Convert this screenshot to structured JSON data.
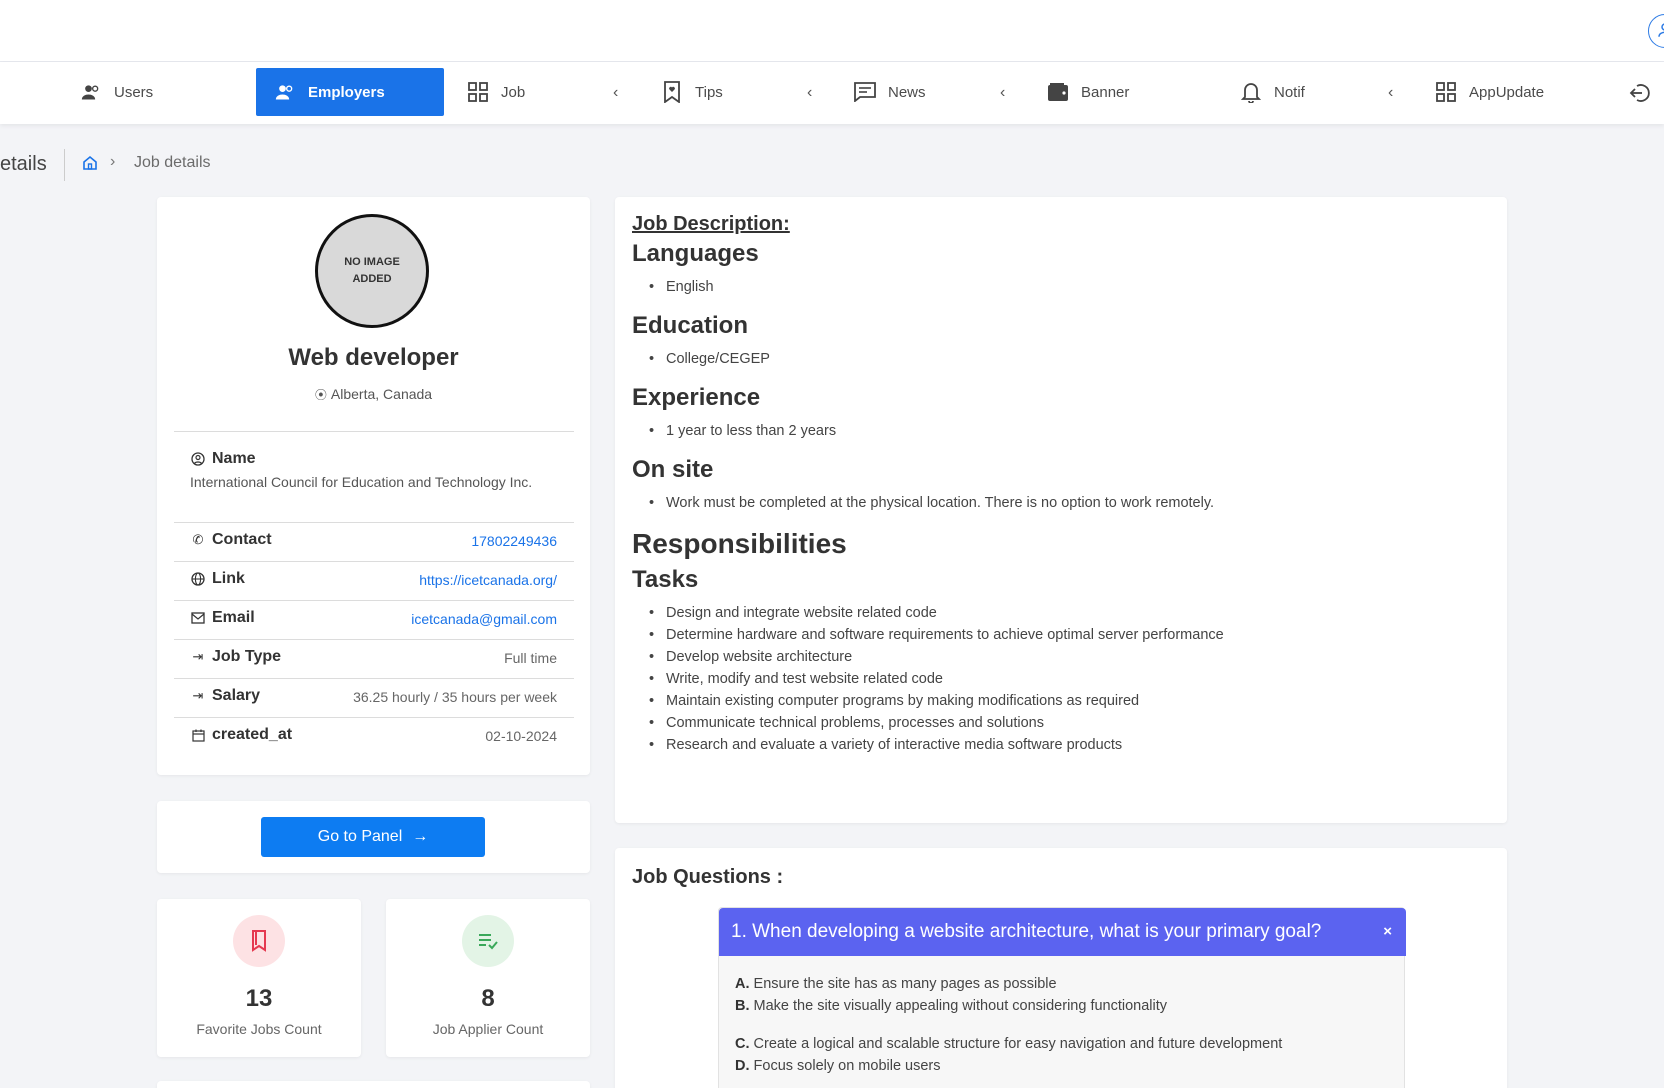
{
  "nav": {
    "items": [
      {
        "label": "Users",
        "icon": "users-icon"
      },
      {
        "label": "Employers",
        "icon": "users-icon"
      },
      {
        "label": "Job",
        "icon": "grid-icon"
      },
      {
        "label": "Tips",
        "icon": "bookmark-heart-icon"
      },
      {
        "label": "News",
        "icon": "message-icon"
      },
      {
        "label": "Banner",
        "icon": "wallet-icon"
      },
      {
        "label": "Notif",
        "icon": "bell-icon"
      },
      {
        "label": "AppUpdate",
        "icon": "grid-icon"
      }
    ],
    "active": "Employers",
    "accent": "#1a73e8"
  },
  "breadcrumb": {
    "title": "etails",
    "current": "Job details"
  },
  "profile": {
    "no_image_text": "NO IMAGE ADDED",
    "job_title": "Web developer",
    "location": "Alberta, Canada",
    "rows": {
      "name_label": "Name",
      "name_value": "International Council for Education and Technology Inc.",
      "contact_label": "Contact",
      "contact_value": "17802249436",
      "link_label": "Link",
      "link_value": "https://icetcanada.org/",
      "email_label": "Email",
      "email_value": "icetcanada@gmail.com",
      "jobtype_label": "Job Type",
      "jobtype_value": "Full time",
      "salary_label": "Salary",
      "salary_value": "36.25 hourly / 35 hours per week",
      "created_label": "created_at",
      "created_value": "02-10-2024"
    }
  },
  "panel_button": "Go to Panel",
  "stats": {
    "favorite_count": "13",
    "favorite_label": "Favorite Jobs Count",
    "applier_count": "8",
    "applier_label": "Job Applier Count"
  },
  "description": {
    "heading": "Job Description:",
    "languages_title": "Languages",
    "languages": [
      "English"
    ],
    "education_title": "Education",
    "education": [
      "College/CEGEP"
    ],
    "experience_title": "Experience",
    "experience": [
      "1 year to less than 2 years"
    ],
    "onsite_title": "On site",
    "onsite": [
      "Work must be completed at the physical location. There is no option to work remotely."
    ],
    "responsibilities_title": "Responsibilities",
    "tasks_title": "Tasks",
    "tasks": [
      "Design and integrate website related code",
      "Determine hardware and software requirements to achieve optimal server performance",
      "Develop website architecture",
      "Write, modify and test website related code",
      "Maintain existing computer programs by making modifications as required",
      "Communicate technical problems, processes and solutions",
      "Research and evaluate a variety of interactive media software products"
    ]
  },
  "questions": {
    "title": "Job Questions :",
    "q1": "1. When developing a website architecture, what is your primary goal?",
    "options": [
      {
        "letter": "A.",
        "text": "Ensure the site has as many pages as possible"
      },
      {
        "letter": "B.",
        "text": "Make the site visually appealing without considering functionality"
      },
      {
        "letter": "C.",
        "text": "Create a logical and scalable structure for easy navigation and future development"
      },
      {
        "letter": "D.",
        "text": "Focus solely on mobile users"
      }
    ],
    "close": "×"
  }
}
